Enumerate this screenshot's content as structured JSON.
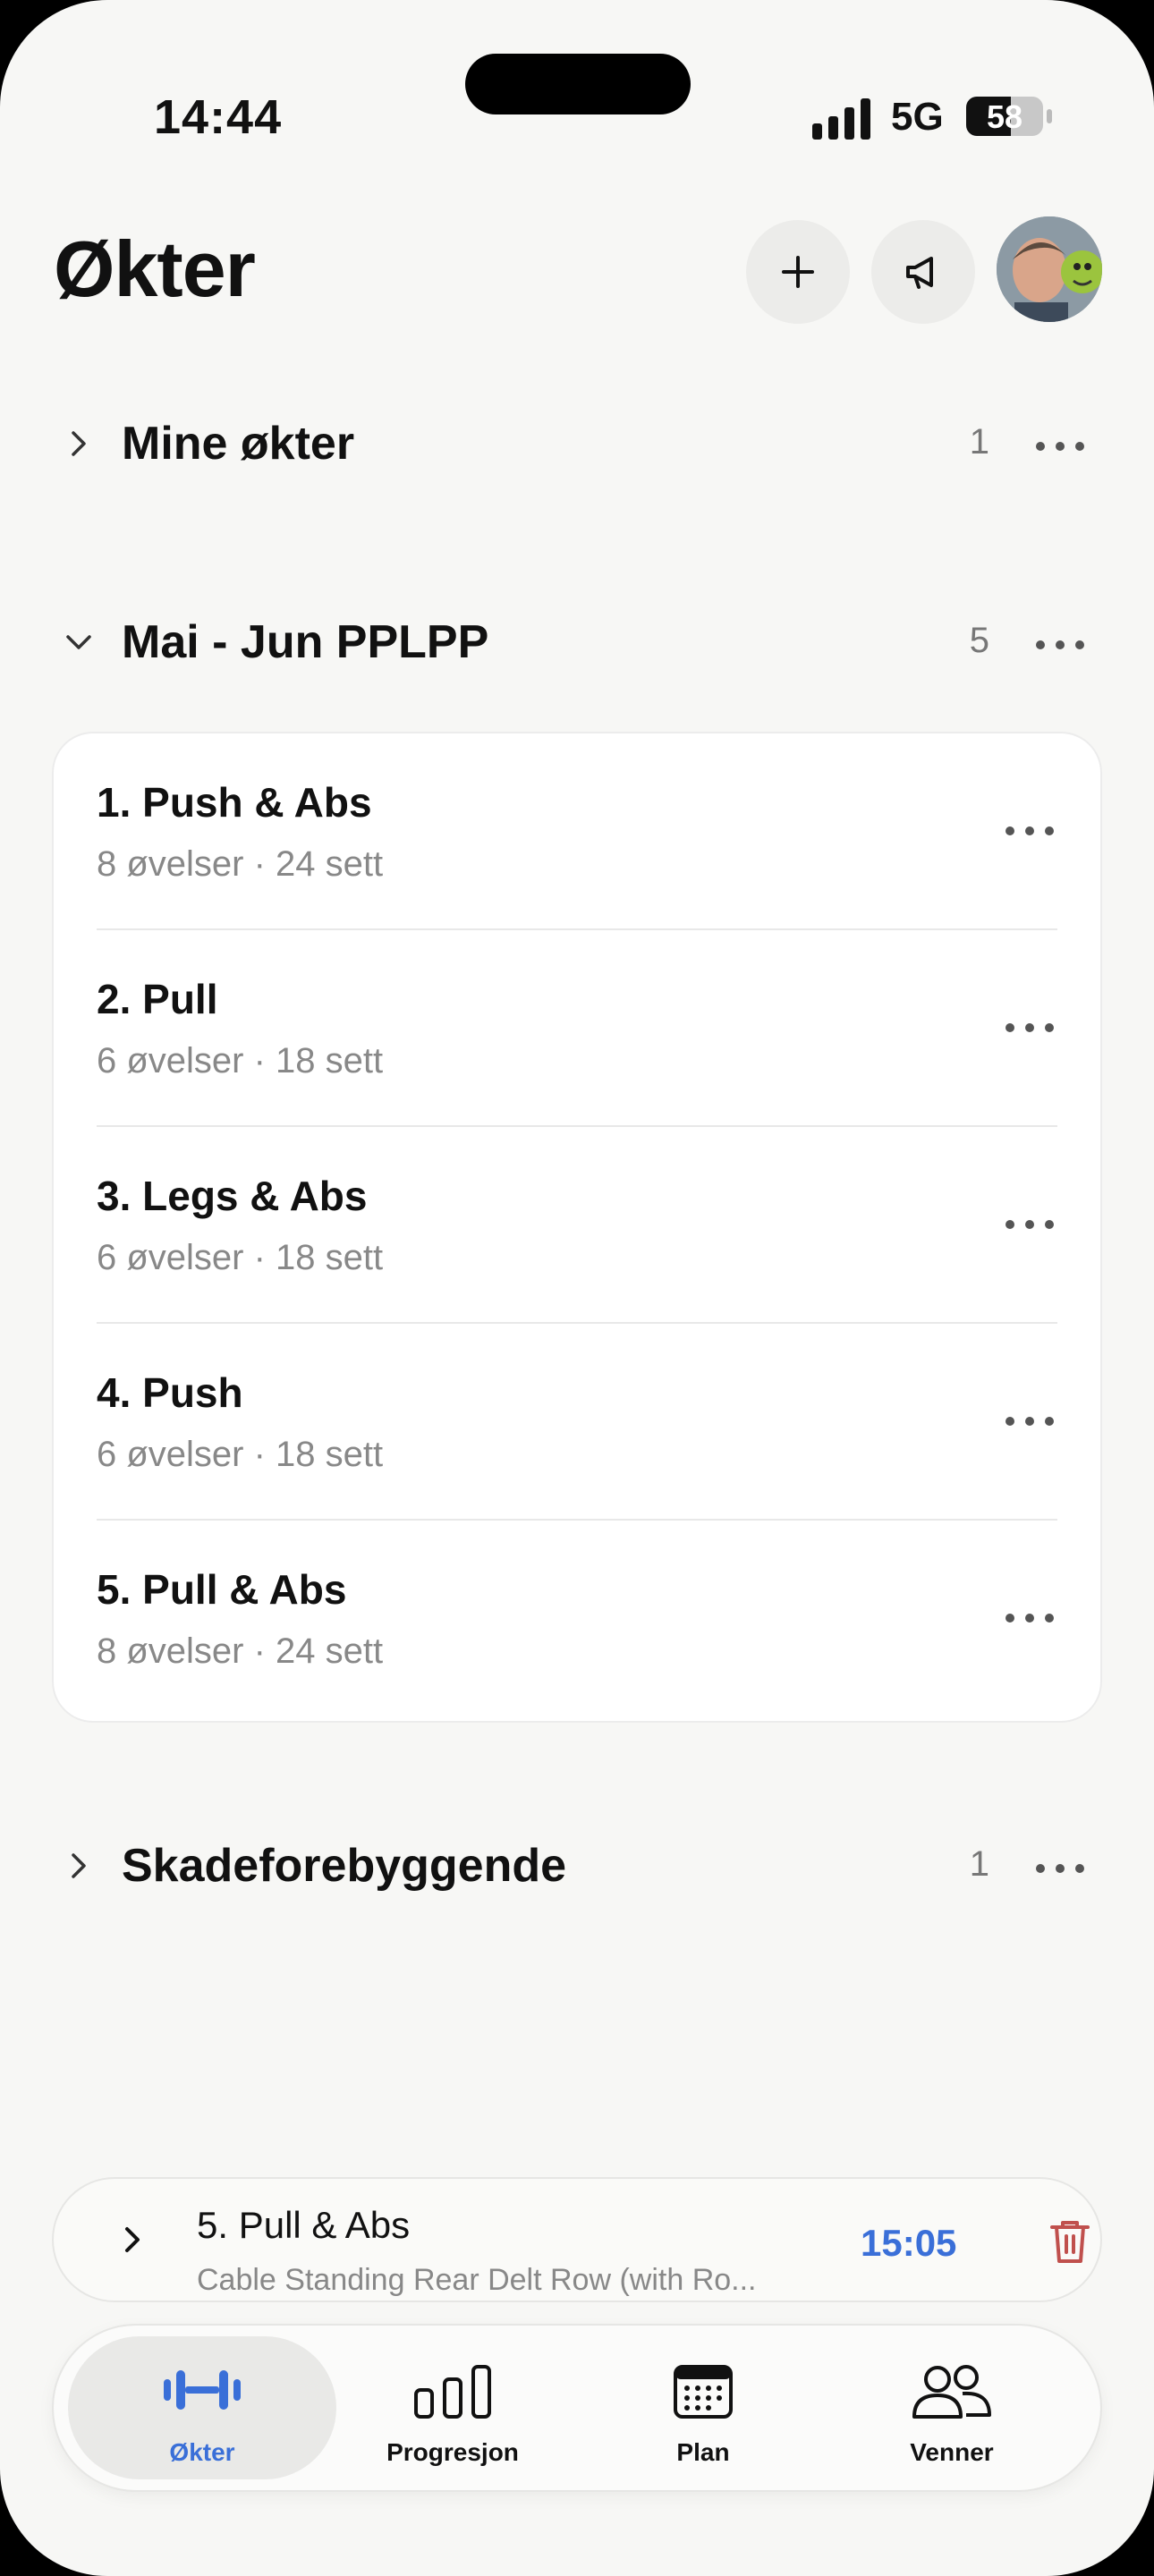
{
  "status_bar": {
    "time": "14:44",
    "network": "5G",
    "battery": "58",
    "battery_level": 0.58
  },
  "header": {
    "title": "Økter",
    "add_icon": "plus-icon",
    "announce_icon": "megaphone-icon",
    "avatar_icon": "avatar"
  },
  "groups": [
    {
      "name": "Mine økter",
      "count": "1",
      "expanded": false
    },
    {
      "name": "Mai - Jun PPLPP",
      "count": "5",
      "expanded": true
    },
    {
      "name": "Skadeforebyggende",
      "count": "1",
      "expanded": false
    }
  ],
  "workouts": [
    {
      "title": "1. Push & Abs",
      "subtitle": "8 øvelser · 24 sett"
    },
    {
      "title": "2. Pull",
      "subtitle": "6 øvelser · 18 sett"
    },
    {
      "title": "3. Legs & Abs",
      "subtitle": "6 øvelser · 18 sett"
    },
    {
      "title": "4. Push",
      "subtitle": "6 øvelser · 18 sett"
    },
    {
      "title": "5. Pull & Abs",
      "subtitle": "8 øvelser · 24 sett"
    }
  ],
  "active_workout": {
    "title": "5. Pull & Abs",
    "exercise": "Cable Standing Rear Delt Row (with Ro...",
    "timer": "15:05",
    "timer_color": "#3a6fd8",
    "delete_color": "#c0504d"
  },
  "tabs": [
    {
      "label": "Økter",
      "icon": "dumbbell-icon",
      "active": true
    },
    {
      "label": "Progresjon",
      "icon": "bar-chart-icon",
      "active": false
    },
    {
      "label": "Plan",
      "icon": "calendar-icon",
      "active": false
    },
    {
      "label": "Venner",
      "icon": "friends-icon",
      "active": false
    }
  ],
  "accent_color": "#3a6fd8"
}
